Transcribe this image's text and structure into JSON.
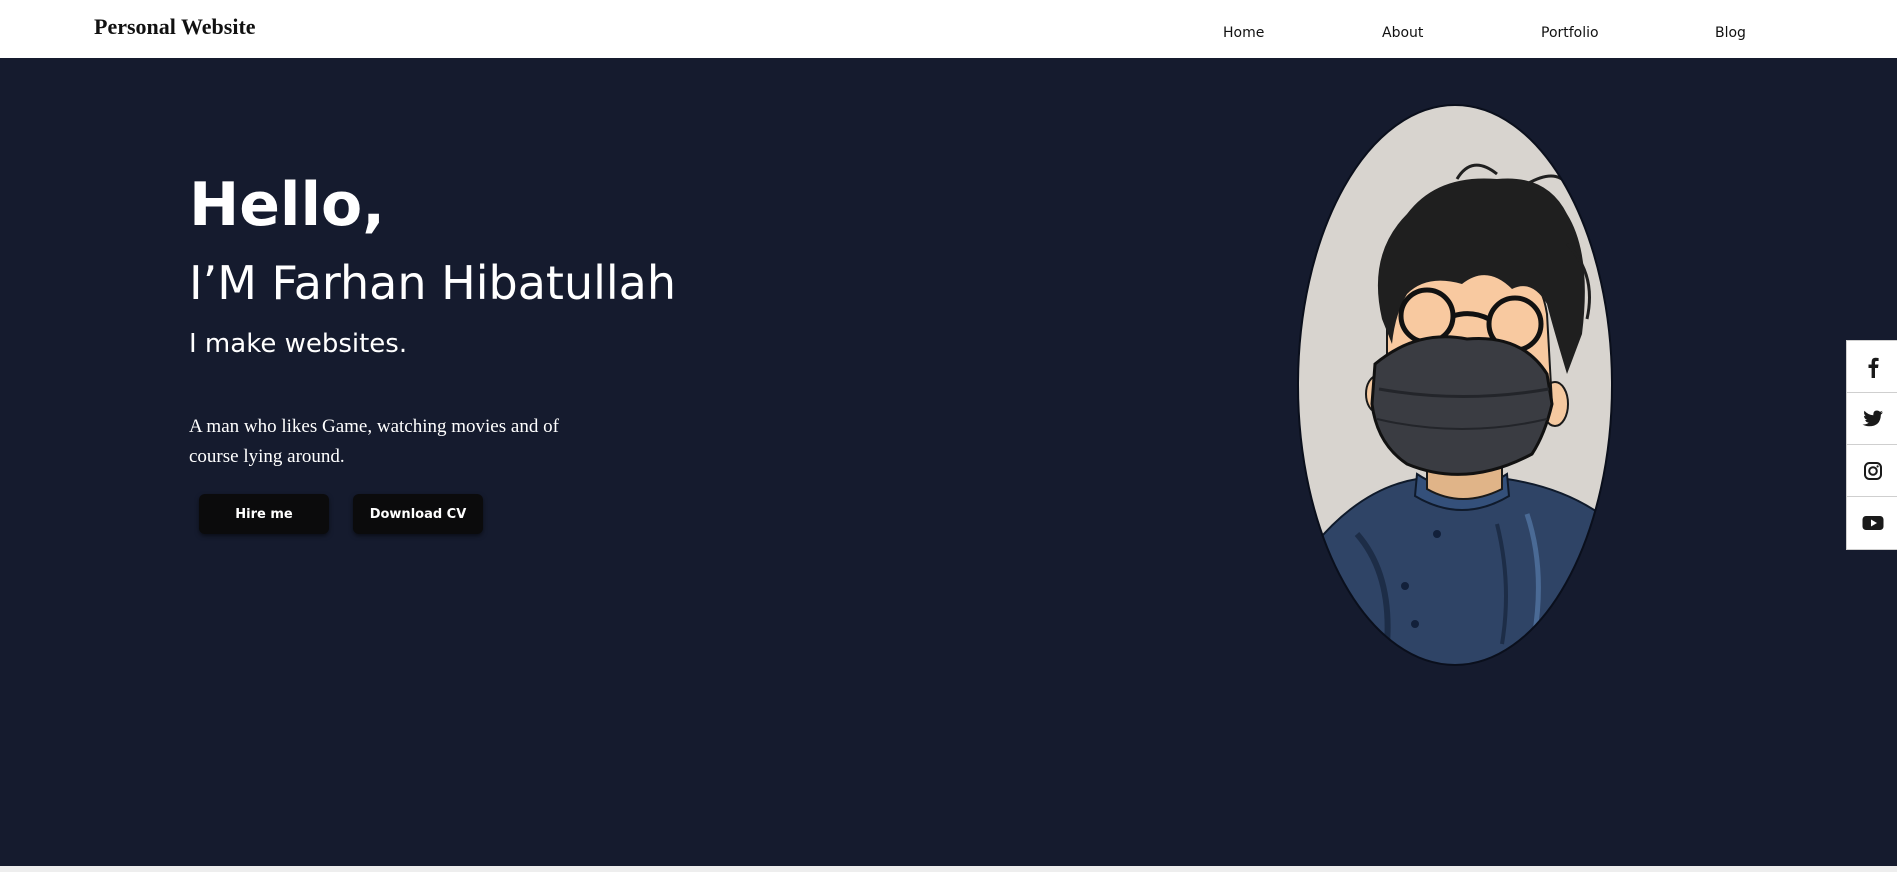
{
  "navbar": {
    "brand": "Personal Website",
    "links": [
      "Home",
      "About",
      "Portfolio",
      "Blog"
    ]
  },
  "hero": {
    "greeting": "Hello,",
    "name": "I’M Farhan Hibatullah",
    "tagline": "I make websites.",
    "description": "A man who likes Game, watching movies and of course lying around.",
    "buttons": {
      "hire": "Hire me",
      "download": "Download CV"
    }
  },
  "social": [
    "facebook-icon",
    "twitter-icon",
    "instagram-icon",
    "youtube-icon"
  ],
  "colors": {
    "hero_background": "#151b2e",
    "button_background": "#0b0b0c",
    "navbar_background": "#ffffff"
  }
}
